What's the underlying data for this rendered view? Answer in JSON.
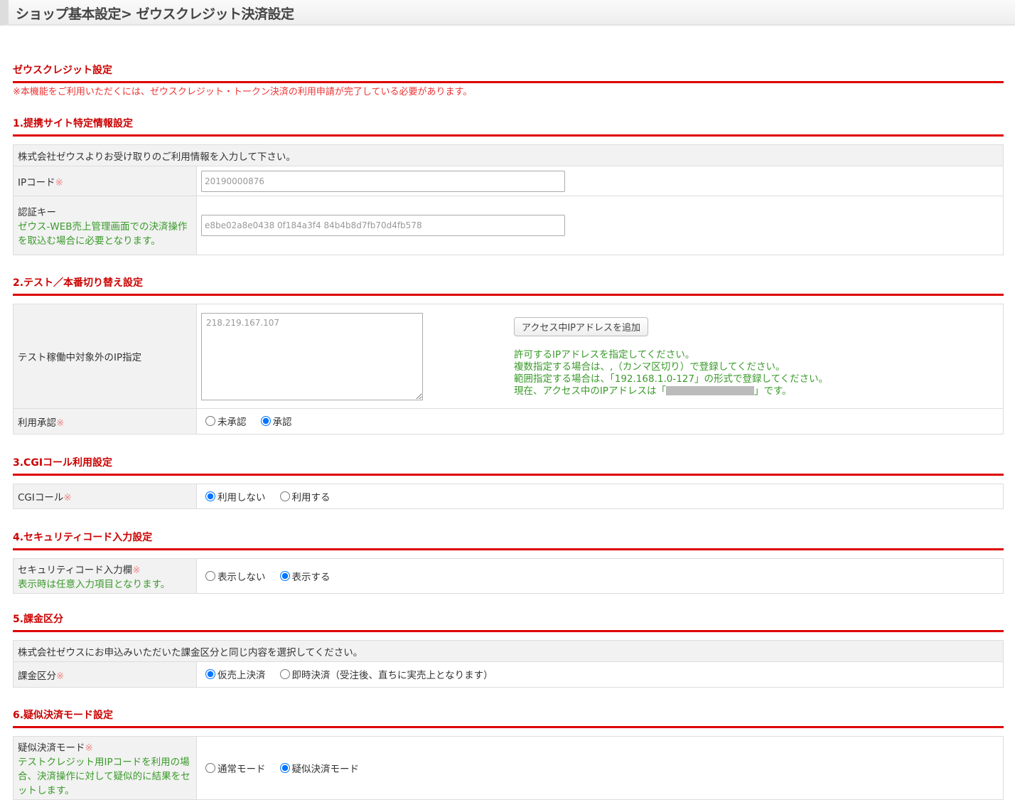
{
  "header": {
    "title": "ショップ基本設定> ゼウスクレジット決済設定"
  },
  "main": {
    "title": "ゼウスクレジット設定",
    "notice": "※本機能をご利用いただくには、ゼウスクレジット・トークン決済の利用申請が完了している必要があります。"
  },
  "req_mark": "※",
  "s1": {
    "title": "1.提携サイト特定情報設定",
    "intro": "株式会社ゼウスよりお受け取りのご利用情報を入力して下さい。",
    "ip_label": "IPコード",
    "ip_value": "20190000876",
    "key_label": "認証キー",
    "key_help": "ゼウス-WEB売上管理画面での決済操作を取込む場合に必要となります。",
    "key_value": "e8be02a8e0438 0f184a3f4 84b4b8d7fb70d4fb578"
  },
  "s2": {
    "title": "2.テスト／本番切り替え設定",
    "ip_label": "テスト稼働中対象外のIP指定",
    "ip_value": "218.219.167.107",
    "add_button": "アクセス中IPアドレスを追加",
    "help": [
      "許可するIPアドレスを指定してください。",
      "複数指定する場合は、,（カンマ区切り）で登録してください。",
      "範囲指定する場合は、「192.168.1.0-127」の形式で登録してください。"
    ],
    "current_pre": "現在、アクセス中のIPアドレスは「",
    "current_post": "」です。",
    "approve_label": "利用承認",
    "options": [
      "未承認",
      "承認"
    ],
    "selected": 1
  },
  "s3": {
    "title": "3.CGIコール利用設定",
    "label": "CGIコール",
    "options": [
      "利用しない",
      "利用する"
    ],
    "selected": 0
  },
  "s4": {
    "title": "4.セキュリティコード入力設定",
    "label": "セキュリティコード入力欄",
    "help": "表示時は任意入力項目となります。",
    "options": [
      "表示しない",
      "表示する"
    ],
    "selected": 1
  },
  "s5": {
    "title": "5.課金区分",
    "intro": "株式会社ゼウスにお申込みいただいた課金区分と同じ内容を選択してください。",
    "label": "課金区分",
    "options": [
      "仮売上決済",
      "即時決済（受注後、直ちに実売上となります）"
    ],
    "selected": 0
  },
  "s6": {
    "title": "6.疑似決済モード設定",
    "label": "疑似決済モード",
    "help": "テストクレジット用IPコードを利用の場合、決済操作に対して疑似的に結果をセットします。",
    "options": [
      "通常モード",
      "疑似決済モード"
    ],
    "selected": 1
  }
}
